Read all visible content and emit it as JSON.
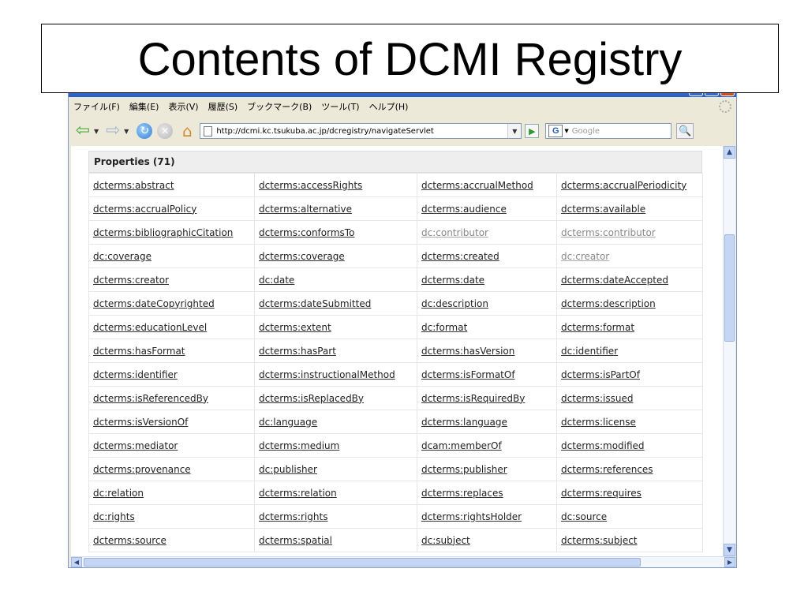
{
  "slide": {
    "title": "Contents of DCMI Registry"
  },
  "browser": {
    "menu": [
      "ファイル(F)",
      "編集(E)",
      "表示(V)",
      "履歴(S)",
      "ブックマーク(B)",
      "ツール(T)",
      "ヘルプ(H)"
    ],
    "url": "http://dcmi.kc.tsukuba.ac.jp/dcregistry/navigateServlet",
    "search_placeholder": "Google",
    "icons": [
      "back-arrow-icon",
      "forward-arrow-icon",
      "reload-icon",
      "stop-icon",
      "home-icon",
      "page-icon",
      "go-icon",
      "google-logo-icon",
      "search-icon",
      "throbber-icon"
    ]
  },
  "properties": {
    "header": "Properties (71)",
    "rows": [
      [
        "dcterms:abstract",
        "dcterms:accessRights",
        "dcterms:accrualMethod",
        "dcterms:accrualPeriodicity"
      ],
      [
        "dcterms:accrualPolicy",
        "dcterms:alternative",
        "dcterms:audience",
        "dcterms:available"
      ],
      [
        "dcterms:bibliographicCitation",
        "dcterms:conformsTo",
        "dc:contributor",
        "dcterms:contributor"
      ],
      [
        "dc:coverage",
        "dcterms:coverage",
        "dcterms:created",
        "dc:creator"
      ],
      [
        "dcterms:creator",
        "dc:date",
        "dcterms:date",
        "dcterms:dateAccepted"
      ],
      [
        "dcterms:dateCopyrighted",
        "dcterms:dateSubmitted",
        "dc:description",
        "dcterms:description"
      ],
      [
        "dcterms:educationLevel",
        "dcterms:extent",
        "dc:format",
        "dcterms:format"
      ],
      [
        "dcterms:hasFormat",
        "dcterms:hasPart",
        "dcterms:hasVersion",
        "dc:identifier"
      ],
      [
        "dcterms:identifier",
        "dcterms:instructionalMethod",
        "dcterms:isFormatOf",
        "dcterms:isPartOf"
      ],
      [
        "dcterms:isReferencedBy",
        "dcterms:isReplacedBy",
        "dcterms:isRequiredBy",
        "dcterms:issued"
      ],
      [
        "dcterms:isVersionOf",
        "dc:language",
        "dcterms:language",
        "dcterms:license"
      ],
      [
        "dcterms:mediator",
        "dcterms:medium",
        "dcam:memberOf",
        "dcterms:modified"
      ],
      [
        "dcterms:provenance",
        "dc:publisher",
        "dcterms:publisher",
        "dcterms:references"
      ],
      [
        "dc:relation",
        "dcterms:relation",
        "dcterms:replaces",
        "dcterms:requires"
      ],
      [
        "dc:rights",
        "dcterms:rights",
        "dcterms:rightsHolder",
        "dc:source"
      ],
      [
        "dcterms:source",
        "dcterms:spatial",
        "dc:subject",
        "dcterms:subject"
      ]
    ],
    "visited": [
      "dc:contributor",
      "dcterms:contributor",
      "dc:creator"
    ]
  },
  "colors": {
    "link": "#222222",
    "visited_link": "#888888",
    "header_bg": "#eeeeee",
    "browser_chrome": "#ece9d8"
  }
}
